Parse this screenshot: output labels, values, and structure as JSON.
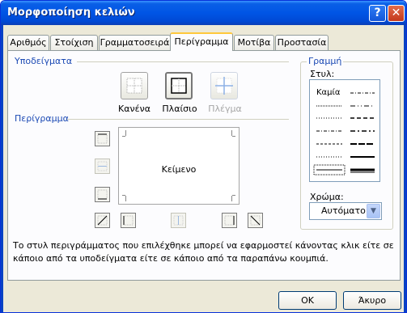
{
  "window": {
    "title": "Μορφοποίηση κελιών"
  },
  "titlebar_buttons": {
    "help": "?",
    "close": "✕"
  },
  "tabs": [
    {
      "label": "Αριθμός"
    },
    {
      "label": "Στοίχιση"
    },
    {
      "label": "Γραμματοσειρά"
    },
    {
      "label": "Περίγραμμα",
      "active": true
    },
    {
      "label": "Μοτίβα"
    },
    {
      "label": "Προστασία"
    }
  ],
  "presets": {
    "group_label": "Υποδείγματα",
    "none_label": "Κανένα",
    "outline_label": "Πλαίσιο",
    "inside_label": "Πλέγμα"
  },
  "border": {
    "group_label": "Περίγραμμα",
    "preview_text": "Κείμενο"
  },
  "line": {
    "group_label": "Γραμμή",
    "style_label": "Στυλ:",
    "none_style": "Καμία",
    "color_label": "Χρώμα:",
    "color_value": "Αυτόματο"
  },
  "hint": "Το στυλ περιγράμματος που επιλέχθηκε μπορεί να εφαρμοστεί κάνοντας κλικ είτε σε κάποιο από τα υποδείγματα είτε σε κάποιο από τα παραπάνω κουμπιά.",
  "footer": {
    "ok": "OK",
    "cancel": "Άκυρο"
  },
  "colors": {
    "title_bar": "#0055e5",
    "group_label": "#1c4ab4",
    "active_tab": "#ffc83c",
    "dialog_bg": "#ece9d8"
  }
}
